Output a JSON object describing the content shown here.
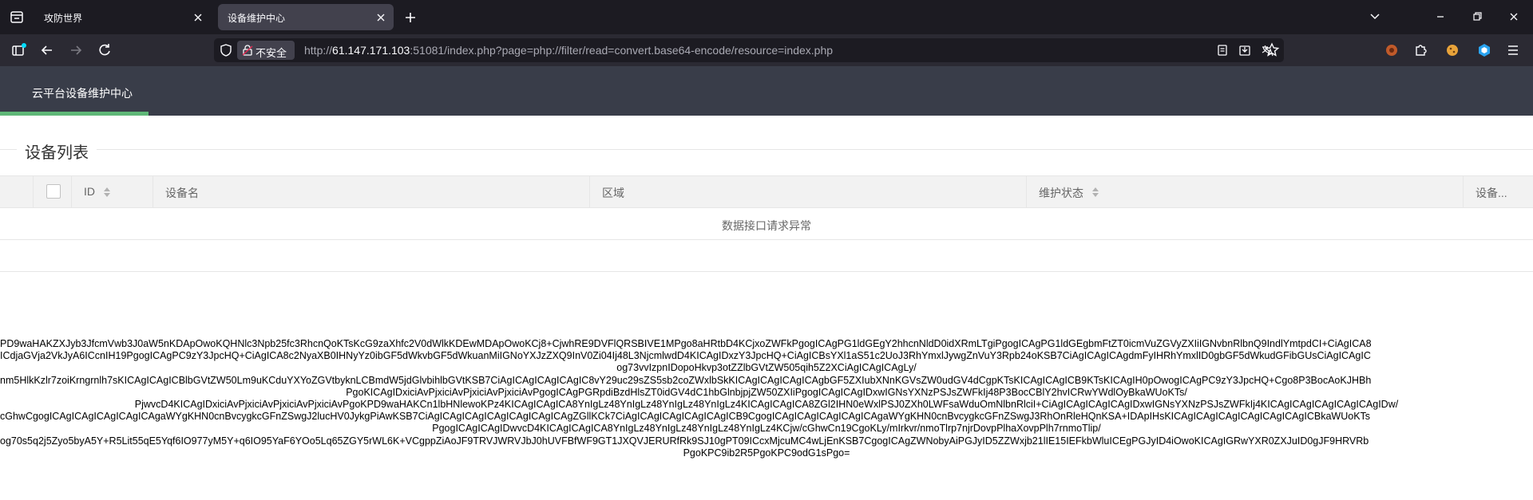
{
  "browser": {
    "tabs": [
      {
        "title": "攻防世界"
      },
      {
        "title": "设备维护中心"
      }
    ],
    "url": {
      "security_label": "不安全",
      "scheme": "http://",
      "host": "61.147.171.103",
      "rest": ":51081/index.php?page=php://filter/read=convert.base64-encode/resource=index.php"
    },
    "icons": {
      "tab_sidebar": "sidebar-icon",
      "new_tab": "plus-icon",
      "back": "back-arrow-icon",
      "forward": "forward-arrow-icon",
      "reload": "reload-icon",
      "shield": "shield-icon",
      "lock": "insecure-lock-icon"
    },
    "colors": {
      "tabstrip": "#1c1b22",
      "toolbar": "#2b2a33",
      "active_tab": "#42414d"
    }
  },
  "app": {
    "header": {
      "nav_item": "云平台设备维护中心"
    },
    "section_title": "设备列表",
    "table": {
      "columns": [
        "ID",
        "设备名",
        "区域",
        "维护状态",
        "设备..."
      ],
      "empty_message": "数据接口请求异常"
    },
    "colors": {
      "header_bg": "#393d49",
      "active_bar": "#5fb878"
    }
  },
  "raw_output": {
    "lines": [
      "PD9waHAKZXJyb3JfcmVwb3J0aW5nKDApOwoKQHNlc3Npb25fc3RhcnQoKTsKcG9zaXhfc2V0dWlkKDEwMDApOwoKCj8+CjwhRE9DVFlQRSBIVE1MPgo8aHRtbD4KCjxoZWFkPgogICAgPG1ldGEgY2hhcnNldD0idXRmLTgiPgogICAgPG1ldGEgbmFtZT0icmVuZGVyZXIiIGNvbnRlbnQ9IndlYmtpdCI+CiAgICA8",
      "ICdjaGVja2VkJyA6ICcnIH19PgogICAgPC9zY3JpcHQ+CiAgICA8c2NyaXB0IHNyYz0ibGF5dWkvbGF5dWkuanMiIGNoYXJzZXQ9InV0Zi04Ij48L3NjcmlwdD4KICAgIDxzY3JpcHQ+CiAgICBsYXl1aS51c2UoJ3RhYmxlJywgZnVuY3Rpb24oKSB7CiAgICAgICAgdmFyIHRhYmxlID0gbGF5dWkudGFibGUsCiAgICAgIC",
      "og73vvIzpnIDopoHkvp3otZZlbGVtZW505qih5Z2XCiAgICAgICAgLy/",
      "nm5HlkKzlr7zoiKrngrnlh7sKICAgICAgICBlbGVtZW50Lm9uKCduYXYoZGVtbyknLCBmdW5jdGlvbihlbGVtKSB7CiAgICAgICAgICAgIC8vY29uc29sZS5sb2coZWxlbSkKICAgICAgICAgICAgbGF5ZXIubXNnKGVsZW0udGV4dCgpKTsKICAgICAgICB9KTsKICAgIH0pOwogICAgPC9zY3JpcHQ+Cgo8P3BocAoKJHBh",
      "PgoKICAgIDxiciAvPjxiciAvPjxiciAvPjxiciAvPgogICAgPGRpdiBzdHlsZT0idGV4dC1hbGlnbjpjZW50ZXIiPgogICAgICAgIDxwIGNsYXNzPSJsZWFkIj48P3BocCBlY2hvICRwYWdlOyBkaWUoKTs/",
      "PjwvcD4KICAgIDxiciAvPjxiciAvPjxiciAvPjxiciAvPgoKPD9waHAKCn1lbHNlewoKPz4KICAgICAgICA8YnIgLz48YnIgLz48YnIgLz48YnIgLz4KICAgICAgICA8ZGl2IHN0eWxlPSJ0ZXh0LWFsaWduOmNlbnRlciI+CiAgICAgICAgICAgIDxwIGNsYXNzPSJsZWFkIj4KICAgICAgICAgICAgICAgIDw/",
      "cGhwCgogICAgICAgICAgICAgICAgaWYgKHN0cnBvcygkcGFnZSwgJ2lucHV0JykgPiAwKSB7CiAgICAgICAgICAgICAgICAgICAgZGllKCk7CiAgICAgICAgICAgICAgICB9CgogICAgICAgICAgICAgICAgaWYgKHN0cnBvcygkcGFnZSwgJ3RhOnRleHQnKSA+IDApIHsKICAgICAgICAgICAgICAgICAgICBkaWUoKTs",
      "PgogICAgICAgIDwvcD4KICAgICAgICA8YnIgLz48YnIgLz48YnIgLz48YnIgLz4KCjw/cGhwCn19CgoKLy/mIrkvr/nmoTlrp7njrDovpPlhaXovpPlh7rnmoTlip/",
      "og70s5q2j5Zyo5byA5Y+R5Lit55qE5Yqf6IO977yM5Y+q6IO95YaF6YOo5Lq65ZGY5rWL6K+VCgppZiAoJF9TRVJWRVJbJ0hUVFBfWF9GT1JXQVJERURfRk9SJ10gPT09ICcxMjcuMC4wLjEnKSB7CgogICAgZWNobyAiPGJyID5ZZWxjb21lIE15IEFkbWluICEgPGJyID4iOwoKICAgIGRwYXR0ZXJuID0gJF9HRVRb",
      "PgoKPC9ib2R5PgoKPC9odG1sPgo="
    ],
    "align": [
      "left",
      "left",
      "center",
      "left",
      "center",
      "center",
      "left",
      "center",
      "left",
      "center"
    ]
  }
}
